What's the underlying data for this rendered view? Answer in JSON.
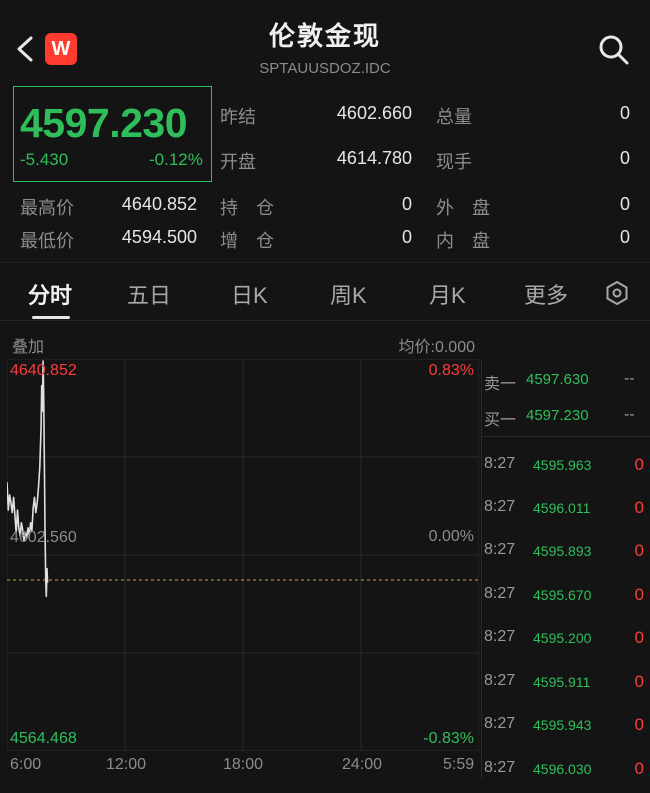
{
  "header": {
    "title": "伦敦金现",
    "subtitle": "SPTAUUSDOZ.IDC",
    "logo_letter": "W"
  },
  "quote": {
    "price": "4597.230",
    "change": "-5.430",
    "change_pct": "-0.12%",
    "prev_close_label": "昨结",
    "prev_close": "4602.660",
    "volume_label": "总量",
    "volume": "0",
    "open_label": "开盘",
    "open": "4614.780",
    "current_hand_label": "现手",
    "current_hand": "0",
    "high_label": "最高价",
    "high": "4640.852",
    "position_label": "持　仓",
    "position": "0",
    "outer_label": "外　盘",
    "outer": "0",
    "low_label": "最低价",
    "low": "4594.500",
    "increase_label": "增　仓",
    "increase": "0",
    "inner_label": "内　盘",
    "inner": "0"
  },
  "tabs": [
    {
      "label": "分时"
    },
    {
      "label": "五日"
    },
    {
      "label": "日K"
    },
    {
      "label": "周K"
    },
    {
      "label": "月K"
    },
    {
      "label": "更多"
    }
  ],
  "chart_header": {
    "overlay_label": "叠加",
    "avg_price_label": "均价:0.000"
  },
  "chart_data": {
    "type": "line",
    "title": "",
    "y_top_label": "4640.852",
    "y_mid_label": "4602.560",
    "y_bottom_label": "4564.468",
    "pct_top": "0.83%",
    "pct_mid": "0.00%",
    "pct_bottom": "-0.83%",
    "x_ticks": [
      "6:00",
      "12:00",
      "18:00",
      "24:00",
      "5:59"
    ],
    "ylim": [
      4564.468,
      4640.852
    ],
    "baseline": 4602.66,
    "x_minutes_from_open": [
      0,
      4,
      8,
      12,
      16,
      20,
      24,
      28,
      32,
      36,
      40,
      44,
      48,
      52,
      56,
      60,
      64,
      68,
      72,
      76,
      80,
      84,
      88,
      92,
      96,
      100,
      104,
      106,
      108,
      110,
      112,
      114,
      116,
      118,
      120,
      122,
      124
    ],
    "y": [
      4617.0,
      4611.5,
      4614.5,
      4613.0,
      4611.0,
      4614.0,
      4610.5,
      4607.0,
      4611.5,
      4608.0,
      4606.5,
      4609.0,
      4607.5,
      4605.5,
      4607.0,
      4606.0,
      4608.0,
      4606.5,
      4609.0,
      4607.5,
      4612.0,
      4614.0,
      4611.0,
      4613.0,
      4616.0,
      4620.0,
      4628.0,
      4636.0,
      4631.0,
      4640.852,
      4634.0,
      4620.0,
      4608.0,
      4598.0,
      4594.5,
      4600.0,
      4597.23
    ]
  },
  "order_book": {
    "ask_label": "卖一",
    "ask_price": "4597.630",
    "ask_vol": "--",
    "bid_label": "买一",
    "bid_price": "4597.230",
    "bid_vol": "--",
    "ticks": [
      {
        "time": "8:27",
        "price": "4595.963",
        "vol": "0"
      },
      {
        "time": "8:27",
        "price": "4596.011",
        "vol": "0"
      },
      {
        "time": "8:27",
        "price": "4595.893",
        "vol": "0"
      },
      {
        "time": "8:27",
        "price": "4595.670",
        "vol": "0"
      },
      {
        "time": "8:27",
        "price": "4595.200",
        "vol": "0"
      },
      {
        "time": "8:27",
        "price": "4595.911",
        "vol": "0"
      },
      {
        "time": "8:27",
        "price": "4595.943",
        "vol": "0"
      },
      {
        "time": "8:27",
        "price": "4596.030",
        "vol": "0"
      }
    ]
  },
  "colors": {
    "up": "#ff3b3b",
    "down": "#2fbf5a",
    "price_line": "#e0e0e0",
    "baseline": "#d4a23a",
    "grid": "#2a2a2a"
  }
}
